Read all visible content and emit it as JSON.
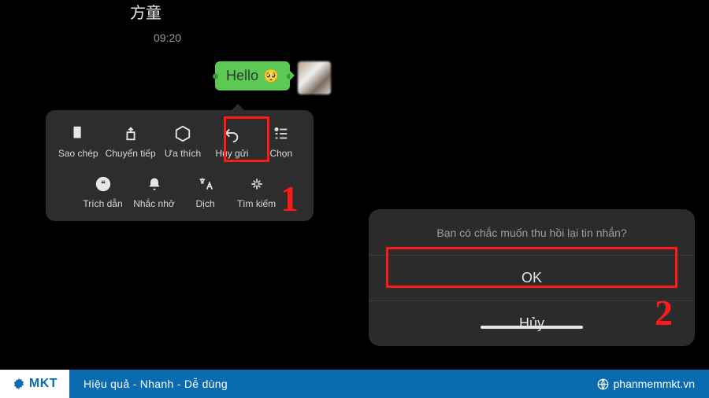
{
  "left": {
    "contact": "方童",
    "time": "09:20",
    "message_text": "Hello",
    "emoji": "🥺"
  },
  "menu": {
    "row1": [
      {
        "label": "Sao chép"
      },
      {
        "label": "Chuyển tiếp"
      },
      {
        "label": "Ưa thích"
      },
      {
        "label": "Hủy gửi"
      },
      {
        "label": "Chọn"
      }
    ],
    "row2": [
      {
        "label": "Trích dẫn"
      },
      {
        "label": "Nhắc nhở"
      },
      {
        "label": "Dịch"
      },
      {
        "label": "Tìm kiếm"
      }
    ]
  },
  "dialog": {
    "title": "Bạn có chắc muốn thu hồi lại tin nhắn?",
    "ok": "OK",
    "cancel": "Hủy"
  },
  "markers": {
    "one": "1",
    "two": "2"
  },
  "footer": {
    "logo_text": "MKT",
    "tagline": "Hiệu quả - Nhanh - Dễ dùng",
    "site": "phanmemmkt.vn"
  }
}
